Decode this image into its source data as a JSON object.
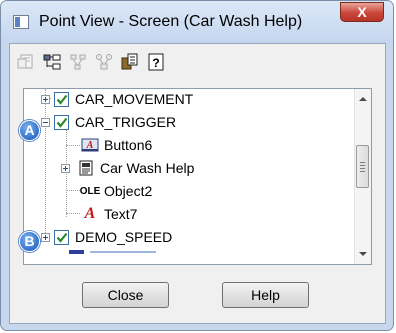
{
  "window": {
    "title": "Point View - Screen (Car Wash Help)",
    "close_glyph": "X"
  },
  "toolbar": [
    {
      "icon": "properties-icon",
      "enabled": false
    },
    {
      "icon": "tree-structure-icon",
      "enabled": true
    },
    {
      "icon": "network-icon",
      "enabled": false
    },
    {
      "icon": "hierarchy-icon",
      "enabled": false
    },
    {
      "icon": "copy-icon",
      "enabled": true
    },
    {
      "icon": "help-icon",
      "enabled": true,
      "label": "?"
    }
  ],
  "tree": {
    "items": [
      {
        "label": "CAR_MOVEMENT",
        "level": 0,
        "expander": "plus",
        "checked": true
      },
      {
        "label": "CAR_TRIGGER",
        "level": 0,
        "expander": "minus",
        "checked": true,
        "callout": "A"
      },
      {
        "label": "Button6",
        "level": 1,
        "icon": "button-object-icon"
      },
      {
        "label": "Car Wash Help",
        "level": 1,
        "expander": "plus",
        "icon": "screen-icon"
      },
      {
        "label": "Object2",
        "level": 1,
        "icon": "ole-object-icon",
        "icon_text": "OLE"
      },
      {
        "label": "Text7",
        "level": 1,
        "icon": "text-object-icon",
        "icon_text": "A"
      },
      {
        "label": "DEMO_SPEED",
        "level": 0,
        "expander": "plus",
        "checked": true,
        "callout": "B"
      }
    ]
  },
  "callouts": [
    "A",
    "B"
  ],
  "buttons": {
    "close_label": "Close",
    "help_label": "Help"
  },
  "colors": {
    "title_bar": "#c4d6ef",
    "close_button": "#c9473a",
    "checkbox_check": "#2a8a2a",
    "callout": "#2f6fcb"
  }
}
